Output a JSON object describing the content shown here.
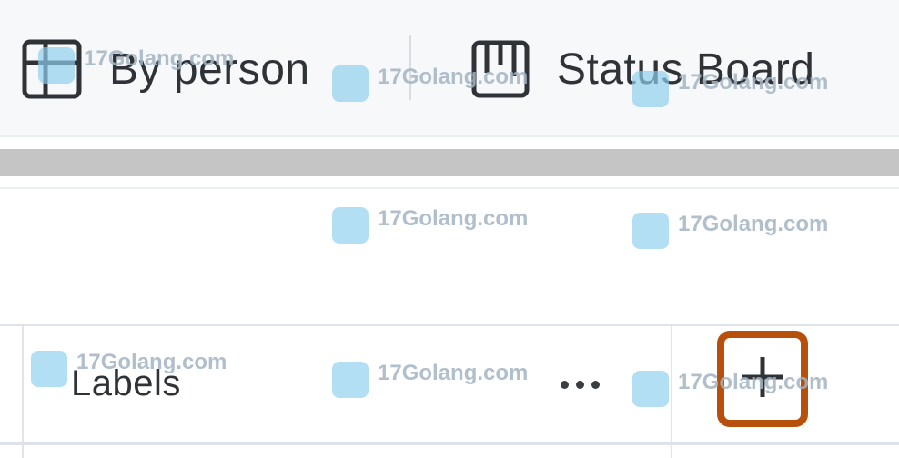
{
  "tabs": [
    {
      "label": "By person",
      "icon": "table-grid-icon"
    },
    {
      "label": "Status Board",
      "icon": "kanban-board-icon"
    }
  ],
  "column_header": {
    "label": "Labels",
    "more_icon": "more-horizontal-icon",
    "add_icon": "plus-icon"
  },
  "watermark": {
    "text": "17Golang.com"
  },
  "colors": {
    "highlight_border": "#b8500d",
    "band": "#c5c5c5",
    "text": "#2f3338"
  }
}
